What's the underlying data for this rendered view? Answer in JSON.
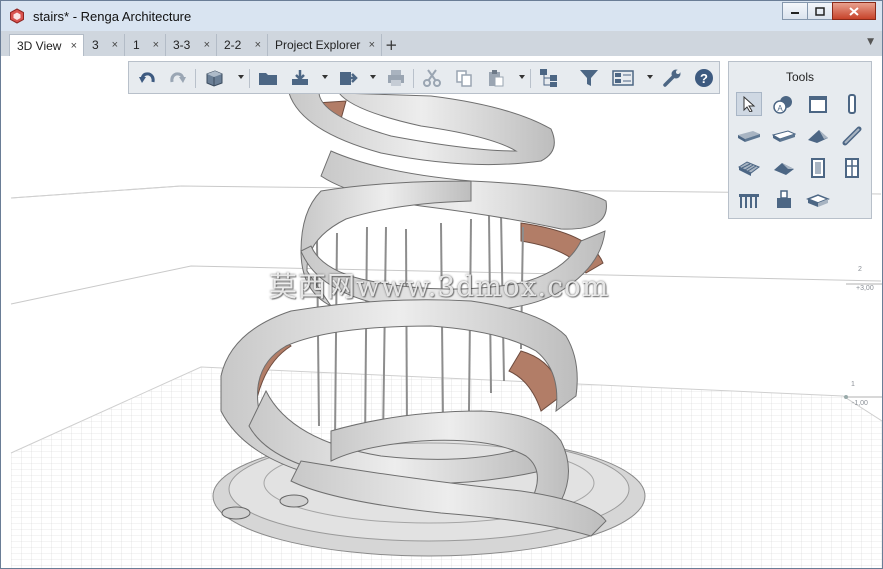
{
  "window": {
    "title": "stairs* - Renga Architecture"
  },
  "tabs": [
    {
      "label": "3D View",
      "active": true
    },
    {
      "label": "3"
    },
    {
      "label": "1"
    },
    {
      "label": "3-3"
    },
    {
      "label": "2-2"
    },
    {
      "label": "Project Explorer"
    }
  ],
  "tab_close_glyph": "×",
  "tab_add_glyph": "+",
  "tab_menu_glyph": "▼",
  "toolbar": {
    "icons": [
      "undo-icon",
      "redo-icon",
      "view-cube-icon",
      "folder-icon",
      "import-icon",
      "export-icon",
      "print-icon",
      "cut-icon",
      "copy-icon",
      "paste-icon",
      "structure-icon",
      "filter-icon",
      "display-settings-icon",
      "wrench-icon",
      "help-icon"
    ]
  },
  "tools_panel": {
    "title": "Tools",
    "icons": [
      "select-icon",
      "annotation-icon",
      "wall-icon",
      "column-icon",
      "slab-icon",
      "floor-icon",
      "roof-icon",
      "beam-icon",
      "stair-icon",
      "ramp-icon",
      "door-icon",
      "window-icon",
      "railing-icon",
      "equipment-icon",
      "opening-icon"
    ]
  },
  "levels": [
    {
      "name": "2",
      "elevation": "+3,00"
    },
    {
      "name": "1",
      "elevation": "-1,00"
    }
  ],
  "watermark": "莫西网www.3dmox.com",
  "colors": {
    "titlebar": "#d9e4f1",
    "tabbar": "#cfd6de",
    "toolbar": "#e7ebef",
    "stair_tread": "#b27d67",
    "stair_wall": "#dcdcdc"
  }
}
